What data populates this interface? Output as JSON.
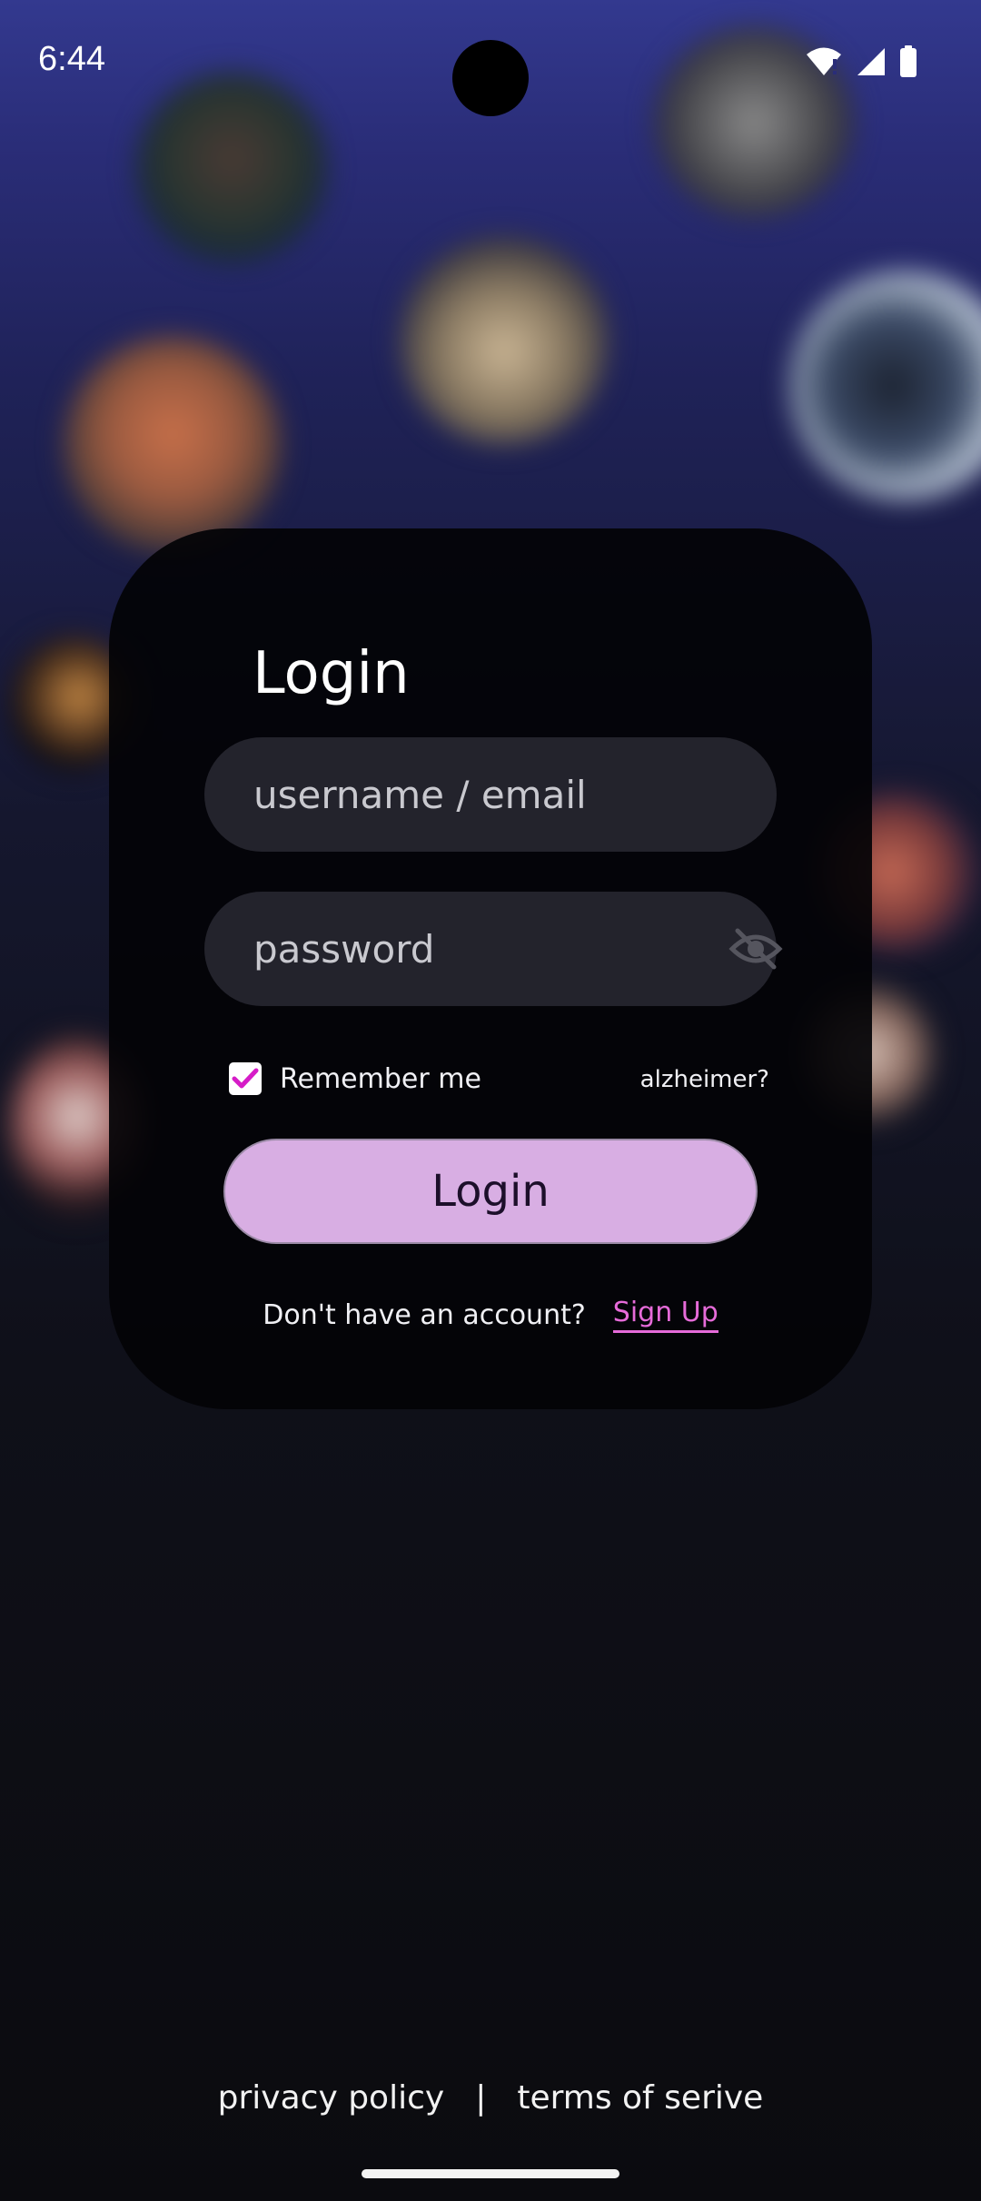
{
  "status_bar": {
    "time": "6:44",
    "icons": [
      "wifi-alert-icon",
      "signal-icon",
      "battery-icon"
    ]
  },
  "login_card": {
    "title": "Login",
    "username_placeholder": "username / email",
    "password_placeholder": "password",
    "password_visibility_icon": "eye-off-icon",
    "remember_me_label": "Remember me",
    "remember_me_checked": true,
    "forgot_label": "alzheimer?",
    "login_button_label": "Login",
    "signup_prompt": "Don't have an account?",
    "signup_link_label": "Sign Up"
  },
  "footer": {
    "privacy_label": "privacy policy",
    "separator": "|",
    "terms_label": "terms of serive"
  },
  "colors": {
    "accent_pink": "#e66bd9",
    "button_lilac": "#d8aee3",
    "card_bg": "#030306",
    "field_bg": "#23232c",
    "background_top": "#33398f"
  }
}
